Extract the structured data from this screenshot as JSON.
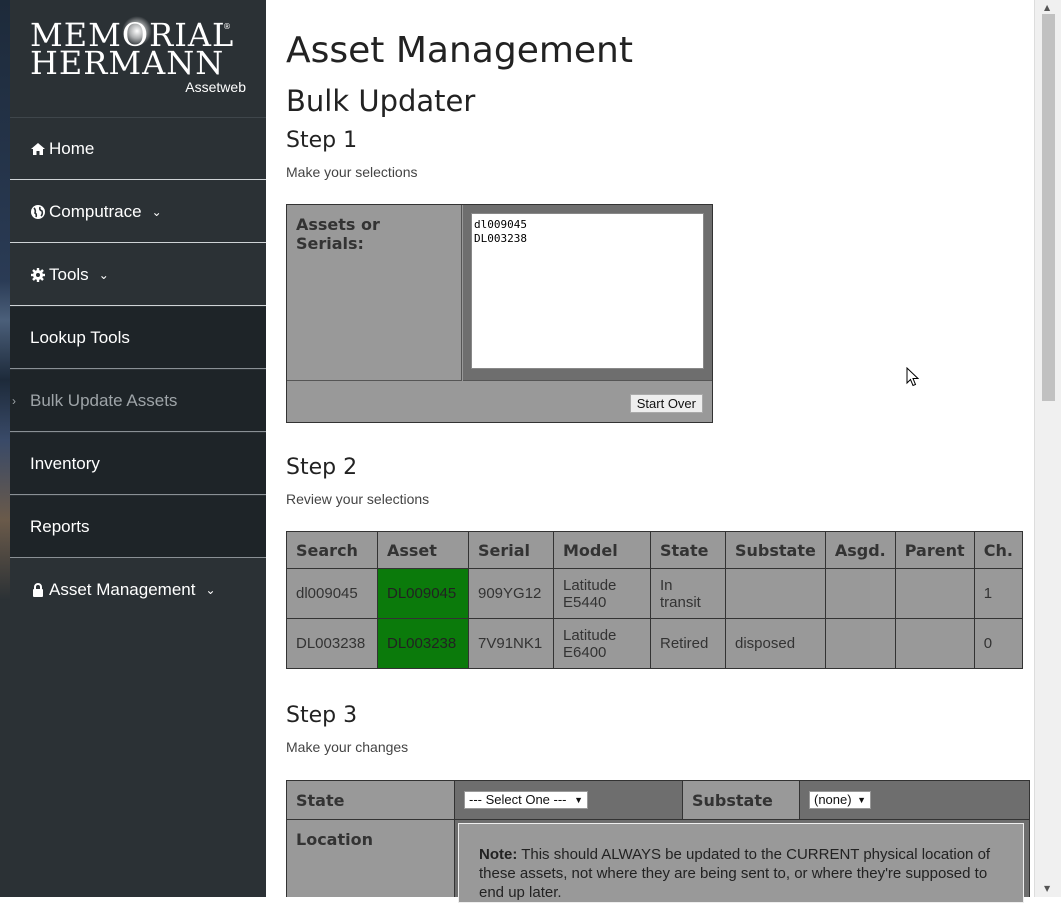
{
  "brand": {
    "line1": "MEMORIAL",
    "line2": "HERMANN",
    "subtitle": "Assetweb"
  },
  "sidebar": {
    "items": [
      {
        "label": "Home",
        "icon": "home-icon"
      },
      {
        "label": "Computrace",
        "icon": "globe-icon"
      },
      {
        "label": "Tools",
        "icon": "gear-icon"
      },
      {
        "label": "Lookup Tools"
      },
      {
        "label": "Bulk Update Assets"
      },
      {
        "label": "Inventory"
      },
      {
        "label": "Reports"
      },
      {
        "label": "Asset Management",
        "icon": "lock-icon"
      }
    ]
  },
  "page": {
    "title": "Asset Management",
    "subtitle": "Bulk Updater"
  },
  "step1": {
    "heading": "Step 1",
    "hint": "Make your selections",
    "field_label": "Assets or Serials:",
    "textarea_value": "dl009045\nDL003238",
    "start_over_label": "Start Over"
  },
  "step2": {
    "heading": "Step 2",
    "hint": "Review your selections",
    "columns": [
      "Search",
      "Asset",
      "Serial",
      "Model",
      "State",
      "Substate",
      "Asgd.",
      "Parent",
      "Ch."
    ],
    "rows": [
      [
        "dl009045",
        "DL009045",
        "909YG12",
        "Latitude E5440",
        "In transit",
        "",
        "",
        "",
        "1"
      ],
      [
        "DL003238",
        "DL003238",
        "7V91NK1",
        "Latitude E6400",
        "Retired",
        "disposed",
        "",
        "",
        "0"
      ]
    ]
  },
  "step3": {
    "heading": "Step 3",
    "hint": "Make your changes",
    "state_label": "State",
    "state_select": "--- Select One ---",
    "substate_label": "Substate",
    "substate_select": "(none)",
    "location_label": "Location",
    "note_bold": "Note:",
    "note_text": " This should ALWAYS be updated to the CURRENT physical location of these assets, not where they are being sent to, or where they're supposed to end up later."
  },
  "colors": {
    "sidebar_bg": "#2b3135",
    "sub_bg": "#1e2428",
    "table_bg": "#999999",
    "asset_match": "#0b7a0b"
  }
}
